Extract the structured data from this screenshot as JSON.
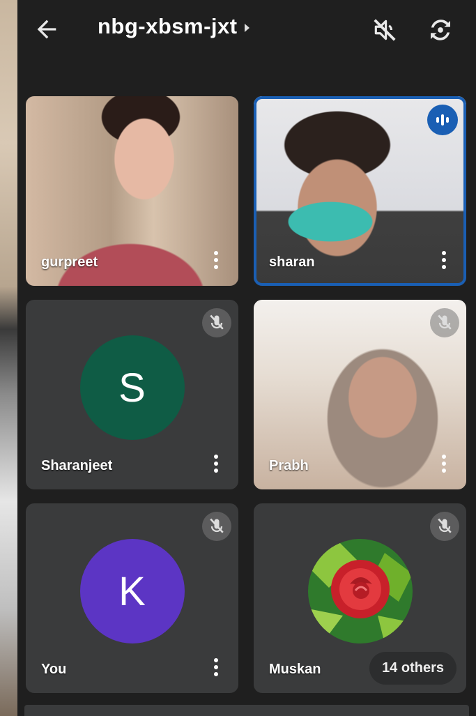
{
  "header": {
    "meeting_code": "nbg-xbsm-jxt",
    "icons": [
      "arrow-left-icon",
      "speaker-off-icon",
      "switch-camera-icon"
    ]
  },
  "participants": [
    {
      "name": "gurpreet",
      "state": "video",
      "muted": false,
      "speaking": false
    },
    {
      "name": "sharan",
      "state": "video",
      "muted": false,
      "speaking": true
    },
    {
      "name": "Sharanjeet",
      "state": "avatar",
      "initial": "S",
      "avatar_color": "#0f5c45",
      "muted": true
    },
    {
      "name": "Prabh",
      "state": "video",
      "muted": true
    },
    {
      "name": "You",
      "state": "avatar",
      "initial": "K",
      "avatar_color": "#5c35c4",
      "muted": true
    },
    {
      "name": "Muskan",
      "state": "avatar-photo",
      "muted": true
    }
  ],
  "others": {
    "label": "14 others"
  },
  "colors": {
    "active_speaker": "#1a5fb4",
    "tile_bg": "#3a3b3c",
    "screen_bg": "#1f1f1f"
  }
}
